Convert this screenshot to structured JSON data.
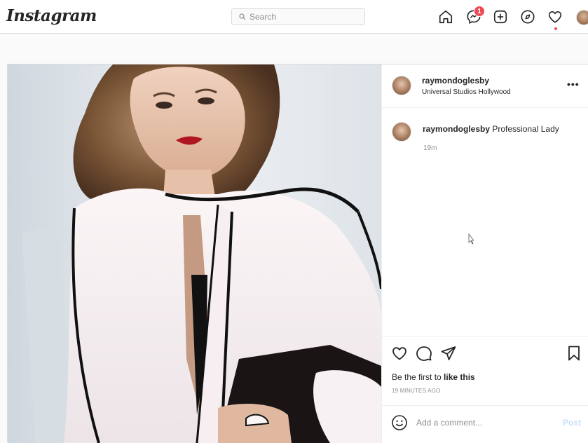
{
  "app": {
    "logo_text": "Instagram"
  },
  "search": {
    "placeholder": "Search"
  },
  "nav": {
    "icons": [
      "home-icon",
      "direct-messages-icon",
      "new-post-icon",
      "explore-icon",
      "activity-heart-icon",
      "profile-avatar"
    ],
    "messages_badge": "1"
  },
  "post": {
    "username": "raymondoglesby",
    "location": "Universal Studios Hollywood",
    "more_label": "•••",
    "caption": {
      "username": "raymondoglesby",
      "text": "Professional Lady",
      "time": "19m"
    },
    "likes": {
      "prefix": "Be the first to ",
      "link": "like this"
    },
    "timestamp": "19 MINUTES AGO",
    "comment": {
      "placeholder": "Add a comment...",
      "post_label": "Post"
    }
  },
  "colors": {
    "badge": "#ed4956",
    "border": "#dbdbdb",
    "post_button_disabled": "#c7dffa",
    "secondary_text": "#8e8e8e"
  }
}
